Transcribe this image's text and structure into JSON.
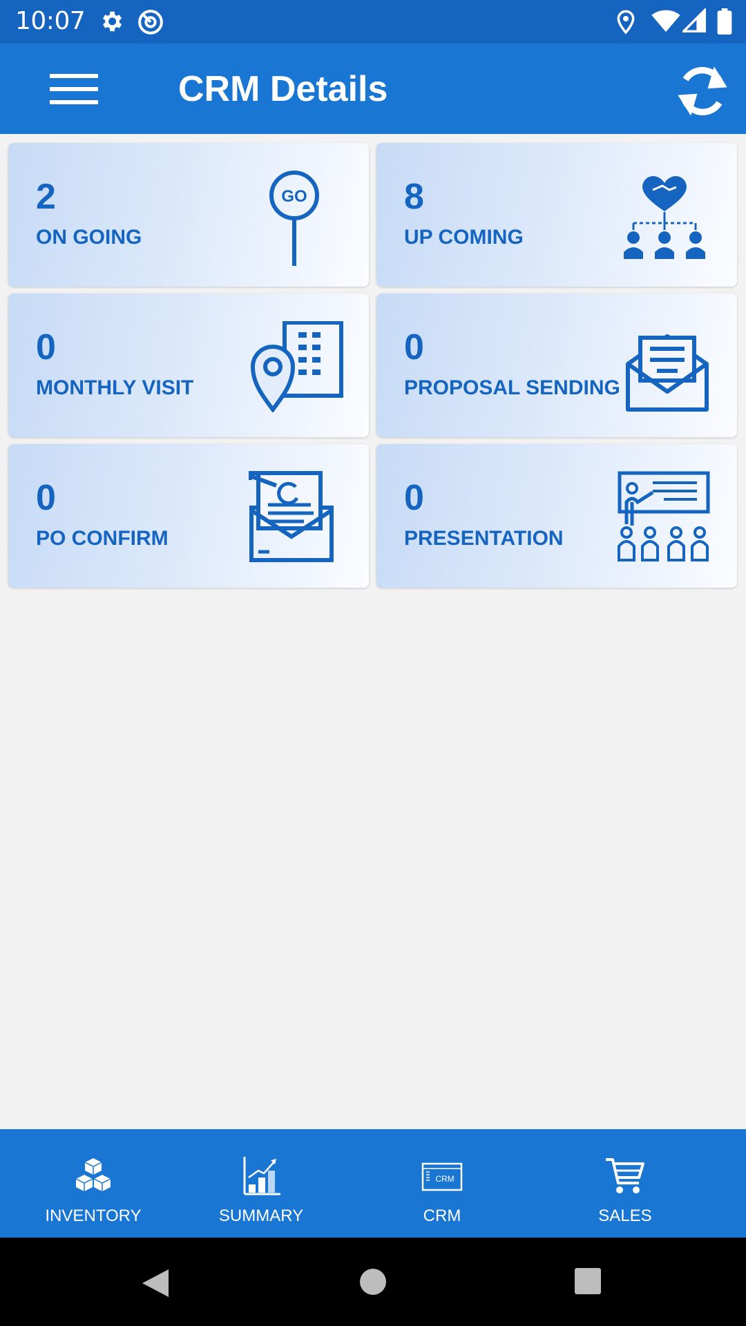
{
  "status_bar": {
    "time": "10:07",
    "left_icons": [
      "gear-icon",
      "at-sign-icon"
    ],
    "right_icons": [
      "location-icon",
      "wifi-icon",
      "signal-icon",
      "battery-icon"
    ]
  },
  "app_bar": {
    "title": "CRM Details",
    "menu_icon": "hamburger-menu-icon",
    "refresh_icon": "refresh-icon"
  },
  "cards": [
    {
      "count": "2",
      "label": "ON GOING",
      "icon": "go-sign-icon"
    },
    {
      "count": "8",
      "label": "UP COMING",
      "icon": "team-handshake-icon"
    },
    {
      "count": "0",
      "label": "MONTHLY VISIT",
      "icon": "building-location-icon"
    },
    {
      "count": "0",
      "label": "PROPOSAL SENDING",
      "icon": "envelope-letter-icon"
    },
    {
      "count": "0",
      "label": "PO CONFIRM",
      "icon": "document-envelope-icon"
    },
    {
      "count": "0",
      "label": "PRESENTATION",
      "icon": "presentation-board-icon"
    }
  ],
  "bottom_nav": [
    {
      "label": "INVENTORY",
      "icon": "cubes-icon"
    },
    {
      "label": "SUMMARY",
      "icon": "bar-chart-icon"
    },
    {
      "label": "CRM",
      "icon": "crm-window-icon"
    },
    {
      "label": "SALES",
      "icon": "shopping-cart-icon"
    }
  ],
  "system_nav": {
    "icons": [
      "back-icon",
      "home-icon",
      "recents-icon"
    ]
  },
  "colors": {
    "status_bar": "#1565c0",
    "app_bar": "#1976d2",
    "accent_text": "#1565c0",
    "background": "#f2f2f2"
  }
}
